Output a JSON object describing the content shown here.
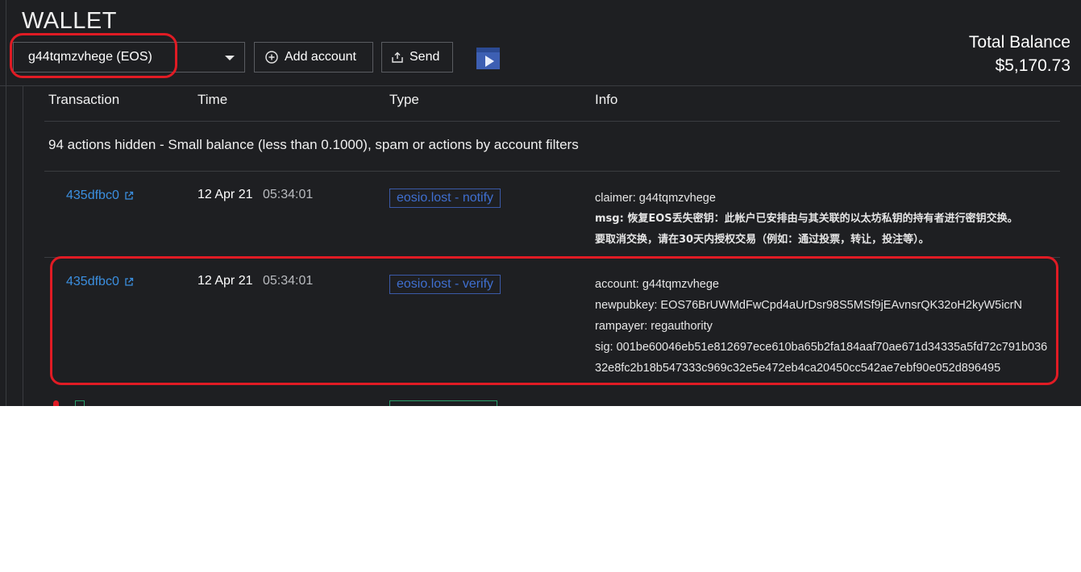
{
  "wallet": {
    "title": "WALLET",
    "account_select": "g44tqmzvhege (EOS)",
    "add_account_label": "Add account",
    "send_label": "Send",
    "total_balance_label": "Total Balance",
    "total_balance_value": "$5,170.73"
  },
  "table": {
    "headers": [
      "Transaction",
      "Time",
      "Type",
      "Info"
    ],
    "hidden_notice": "94 actions hidden - Small balance (less than 0.1000), spam or actions by account filters",
    "rows": [
      {
        "tx": "435dfbc0",
        "date": "12 Apr 21",
        "time": "05:34:01",
        "type": "eosio.lost - notify",
        "info": [
          "claimer: g44tqmzvhege",
          "msg: 恢复EOS丢失密钥：此帐户已安排由与其关联的以太坊私钥的持有者进行密钥交换。",
          "要取消交换，请在30天内授权交易（例如：通过投票，转让，投注等）。"
        ]
      },
      {
        "tx": "435dfbc0",
        "date": "12 Apr 21",
        "time": "05:34:01",
        "type": "eosio.lost - verify",
        "info": [
          "account: g44tqmzvhege",
          "newpubkey: EOS76BrUWMdFwCpd4aUrDsr98S5MSf9jEAvnsrQK32oH2kyW5icrN",
          "rampayer: regauthority",
          "sig: 001be60046eb51e812697ece610ba65b2fa184aaf70ae671d34335a5fd72c791b036",
          "32e8fc2b18b547333c969c32e5e472eb4ca20450cc542ae7ebf90e052d896495"
        ]
      }
    ]
  },
  "colors": {
    "background": "#1e1f22",
    "link": "#3b8fe0",
    "badge": "#3f6fd0",
    "annotation": "#e01b24"
  },
  "icons": [
    "caret-down-icon",
    "plus-circle-icon",
    "share-icon",
    "video-player-icon",
    "external-link-icon"
  ]
}
